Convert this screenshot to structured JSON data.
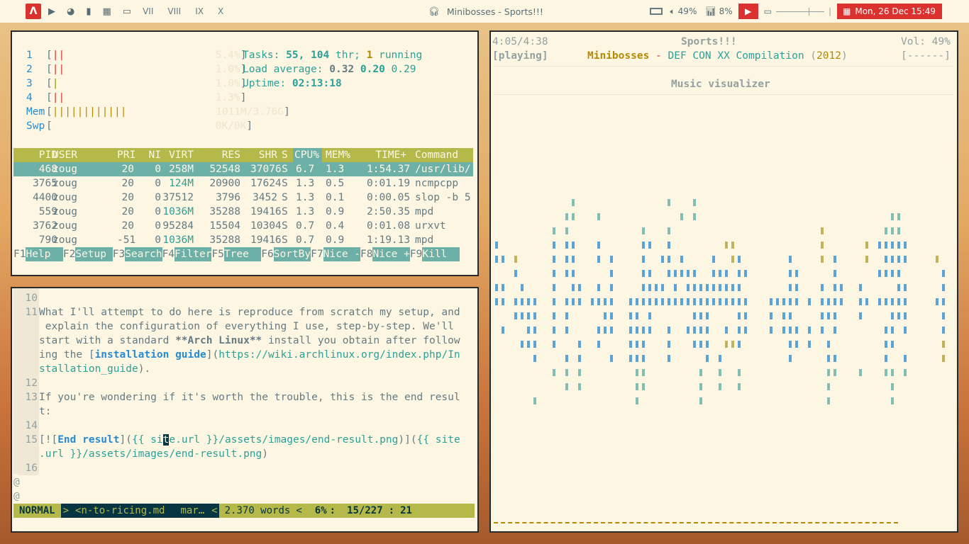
{
  "topbar": {
    "workspaces": [
      "VII",
      "VIII",
      "IX",
      "X"
    ],
    "now_playing": "Minibosses - Sports!!!",
    "volume": "49%",
    "cpu": "8%",
    "date": "Mon, 26 Dec 15:49",
    "icons": [
      "arch-icon",
      "play-circle-icon",
      "firefox-icon",
      "bookmark-icon",
      "film-icon",
      "monitor-icon",
      "headphones-icon",
      "battery-icon",
      "speaker-icon",
      "chart-icon",
      "play-icon",
      "display-icon",
      "calendar-icon"
    ]
  },
  "htop": {
    "cpus": [
      {
        "label": "1",
        "bar": "||",
        "value": "5.4%"
      },
      {
        "label": "2",
        "bar": "||",
        "value": "1.0%"
      },
      {
        "label": "3",
        "bar": "|",
        "value": "1.0%"
      },
      {
        "label": "4",
        "bar": "||",
        "value": "1.3%"
      }
    ],
    "mem": {
      "label": "Mem",
      "bar": "||||||||||||",
      "value": "1011M/3.76G"
    },
    "swp": {
      "label": "Swp",
      "bar": "",
      "value": "0K/0K"
    },
    "tasks_label": "Tasks:",
    "tasks_values": "55, 104",
    "tasks_thr": "thr;",
    "running_num": "1",
    "running_label": "running",
    "load_label": "Load average:",
    "load_1": "0.32",
    "load_5": "0.20",
    "load_15": "0.29",
    "uptime_label": "Uptime:",
    "uptime": "02:13:18",
    "columns": [
      "PID",
      "USER",
      "PRI",
      "NI",
      "VIRT",
      "RES",
      "SHR",
      "S",
      "CPU%",
      "MEM%",
      "TIME+",
      "Command"
    ],
    "processes": [
      [
        "468",
        "zoug",
        "20",
        "0",
        "258M",
        "52548",
        "37076",
        "S",
        "6.7",
        "1.3",
        "1:54.37",
        "/usr/lib/"
      ],
      [
        "3765",
        "zoug",
        "20",
        "0",
        "124M",
        "20900",
        "17624",
        "S",
        "1.3",
        "0.5",
        "0:01.19",
        "ncmpcpp"
      ],
      [
        "4400",
        "zoug",
        "20",
        "0",
        "37512",
        "3796",
        "3452",
        "S",
        "1.3",
        "0.1",
        "0:00.05",
        "slop -b 5"
      ],
      [
        "559",
        "zoug",
        "20",
        "0",
        "1036M",
        "35288",
        "19416",
        "S",
        "1.3",
        "0.9",
        "2:50.35",
        "mpd"
      ],
      [
        "3762",
        "zoug",
        "20",
        "0",
        "95284",
        "15504",
        "10304",
        "S",
        "0.7",
        "0.4",
        "0:01.08",
        "urxvt"
      ],
      [
        "790",
        "zoug",
        "-51",
        "0",
        "1036M",
        "35288",
        "19416",
        "S",
        "0.7",
        "0.9",
        "1:19.13",
        "mpd"
      ]
    ],
    "fkeys": [
      {
        "key": "F1",
        "label": "Help  "
      },
      {
        "key": "F2",
        "label": "Setup "
      },
      {
        "key": "F3",
        "label": "Search"
      },
      {
        "key": "F4",
        "label": "Filter"
      },
      {
        "key": "F5",
        "label": "Tree  "
      },
      {
        "key": "F6",
        "label": "SortBy"
      },
      {
        "key": "F7",
        "label": "Nice -"
      },
      {
        "key": "F8",
        "label": "Nice +"
      },
      {
        "key": "F9",
        "label": "Kill  "
      }
    ]
  },
  "vim": {
    "lines": [
      {
        "num": "10",
        "segments": []
      },
      {
        "num": "11",
        "segments": [
          {
            "t": "What I'll attempt to do here is reproduce from scratch my setup, and",
            "c": "base"
          }
        ]
      },
      {
        "num": "",
        "segments": [
          {
            "t": " explain the configuration of everything I use, step-by-step. We'll",
            "c": "base"
          }
        ]
      },
      {
        "num": "",
        "segments": [
          {
            "t": "start with a standard ",
            "c": "base"
          },
          {
            "t": "**Arch Linux**",
            "c": "bold"
          },
          {
            "t": " install you obtain after follow",
            "c": "base"
          }
        ]
      },
      {
        "num": "",
        "segments": [
          {
            "t": "ing the [",
            "c": "base"
          },
          {
            "t": "installation guide",
            "c": "blue-bold"
          },
          {
            "t": "](",
            "c": "base"
          },
          {
            "t": "https://wiki.archlinux.org/index.php/In",
            "c": "cyan"
          }
        ]
      },
      {
        "num": "",
        "segments": [
          {
            "t": "stallation_guide",
            "c": "cyan"
          },
          {
            "t": ").",
            "c": "base"
          }
        ]
      },
      {
        "num": "12",
        "segments": []
      },
      {
        "num": "13",
        "segments": [
          {
            "t": "If you're wondering if it's worth the trouble, this is the end resul",
            "c": "base"
          }
        ]
      },
      {
        "num": "",
        "segments": [
          {
            "t": "t:",
            "c": "base"
          }
        ]
      },
      {
        "num": "14",
        "segments": []
      },
      {
        "num": "15",
        "segments": [
          {
            "t": "[![",
            "c": "base"
          },
          {
            "t": "End result",
            "c": "blue-bold"
          },
          {
            "t": "](",
            "c": "base"
          },
          {
            "t": "{{ si",
            "c": "cyan"
          },
          {
            "t": "t",
            "c": "cursor"
          },
          {
            "t": "e.url }}/assets/images/end-result.png",
            "c": "cyan"
          },
          {
            "t": ")](",
            "c": "base"
          },
          {
            "t": "{{ site",
            "c": "cyan"
          }
        ]
      },
      {
        "num": "",
        "segments": [
          {
            "t": ".url }}/assets/images/end-result.png",
            "c": "cyan"
          },
          {
            "t": ")",
            "c": "base"
          }
        ]
      },
      {
        "num": "16",
        "segments": []
      }
    ],
    "filler": [
      "@",
      "@"
    ],
    "status": {
      "mode": "NORMAL",
      "sep1": ">",
      "file": "<n-to-ricing.md",
      "ftype": "mar…",
      "sep2": "<",
      "words": "2.370 words",
      "sep3": "<",
      "percent": "6%",
      "colon": ":",
      "position": "15/227",
      "col_sep": ":",
      "col": "21"
    }
  },
  "ncmpcpp": {
    "time": "4:05/4:38",
    "title": "Sports!!!",
    "volume": "Vol: 49%",
    "state": "[playing]",
    "artist": "Minibosses",
    "dash": " - ",
    "album": "DEF CON XX Compilation",
    "year_open": " (",
    "year": "2012",
    "year_close": ")",
    "flags": "[------]",
    "visualizer_title": "Music visualizer",
    "progress": 0.88
  },
  "colors": {
    "base": "#fdf6e3",
    "red": "#dc322f",
    "blue": "#268bd2",
    "cyan": "#2aa198",
    "yellow": "#b58900",
    "green": "#859900"
  }
}
